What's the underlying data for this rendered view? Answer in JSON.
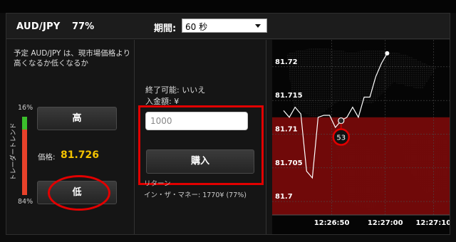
{
  "header": {
    "pair": "AUD/JPY",
    "payout": "77%",
    "period_label": "期間:",
    "period_value": "60 秒"
  },
  "left": {
    "question": "予定 AUD/JPY は、現市場価格より高くなるか低くなるか",
    "trend_label": "トレーダートレンド",
    "trend_top_pct": "16%",
    "trend_bottom_pct": "84%",
    "trend_up_fraction": 0.16,
    "high_button": "高",
    "low_button": "低",
    "price_label": "価格:",
    "price_value": "81.726"
  },
  "middle": {
    "expire": "終了可能: いいえ",
    "balance": "入金額: ¥",
    "amount_value": "1000",
    "buy_button": "購入",
    "return_label": "リターン",
    "return_value": "イン・ザ・マネー: 1770¥ (77%)"
  },
  "colors": {
    "price": "#f2c200",
    "trend_up": "#3bbf2c",
    "trend_down": "#e8412a",
    "highlight": "#e10000",
    "chart_down_zone": "#7a0a0a"
  },
  "chart_data": {
    "type": "line",
    "y_ticks": [
      "81.72",
      "81.715",
      "81.71",
      "81.705",
      "81.7"
    ],
    "x_ticks": [
      "12:26:50",
      "12:27:00",
      "12:27:10"
    ],
    "ylim": [
      81.698,
      81.724
    ],
    "xlim": [
      0,
      26
    ],
    "series": [
      {
        "values": [
          [
            0,
            81.7135
          ],
          [
            1,
            81.7125
          ],
          [
            2,
            81.714
          ],
          [
            3,
            81.713
          ],
          [
            4,
            81.7045
          ],
          [
            5,
            81.7035
          ],
          [
            6,
            81.7125
          ],
          [
            7,
            81.7128
          ],
          [
            8,
            81.7128
          ],
          [
            9,
            81.711
          ],
          [
            10,
            81.712
          ],
          [
            11,
            81.7125
          ],
          [
            12,
            81.714
          ],
          [
            13,
            81.7125
          ],
          [
            14,
            81.7155
          ],
          [
            15,
            81.7155
          ],
          [
            16,
            81.7185
          ],
          [
            17,
            81.7205
          ],
          [
            18,
            81.722
          ]
        ]
      }
    ],
    "entry_rate": 81.7125,
    "entry_index": 10,
    "countdown": "53"
  }
}
